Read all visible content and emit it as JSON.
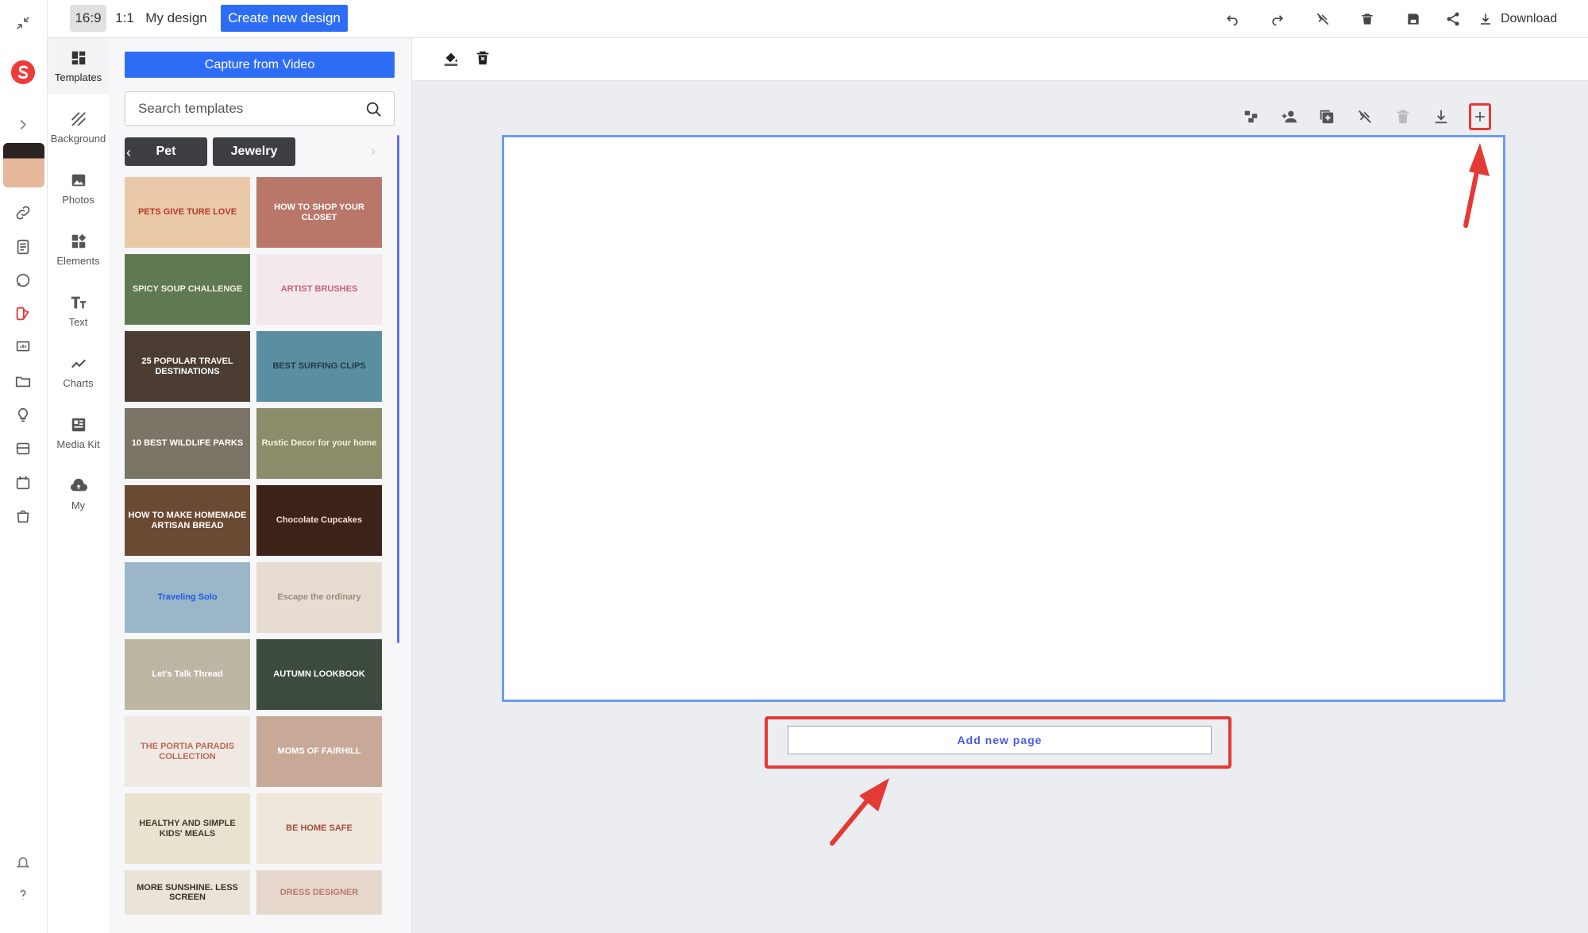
{
  "topbar": {
    "ratio_16_9": "16:9",
    "ratio_1_1": "1:1",
    "my_design": "My design",
    "create_new": "Create new design",
    "download": "Download"
  },
  "tools": [
    {
      "label": "Templates",
      "icon": "templates-icon"
    },
    {
      "label": "Background",
      "icon": "background-icon"
    },
    {
      "label": "Photos",
      "icon": "photos-icon"
    },
    {
      "label": "Elements",
      "icon": "elements-icon"
    },
    {
      "label": "Text",
      "icon": "text-icon"
    },
    {
      "label": "Charts",
      "icon": "charts-icon"
    },
    {
      "label": "Media Kit",
      "icon": "media-kit-icon"
    },
    {
      "label": "My",
      "icon": "upload-cloud-icon"
    }
  ],
  "panel": {
    "capture_button": "Capture from Video",
    "search_placeholder": "Search templates",
    "chips": [
      "Pet",
      "Jewelry"
    ],
    "templates": [
      {
        "text": "PETS GIVE TURE LOVE",
        "bg": "#e9c9a8",
        "fg": "#b23a2a"
      },
      {
        "text": "HOW TO SHOP YOUR CLOSET",
        "bg": "#b9776a",
        "fg": "#ffffff"
      },
      {
        "text": "SPICY SOUP CHALLENGE",
        "bg": "#5f7a52",
        "fg": "#f3efe2"
      },
      {
        "text": "ARTIST BRUSHES",
        "bg": "#f3e8ec",
        "fg": "#c2667c"
      },
      {
        "text": "25 POPULAR TRAVEL DESTINATIONS",
        "bg": "#4b3d34",
        "fg": "#ffffff"
      },
      {
        "text": "BEST SURFING CLIPS",
        "bg": "#5b8ea1",
        "fg": "#1f3a48"
      },
      {
        "text": "10 BEST WILDLIFE PARKS",
        "bg": "#7c7466",
        "fg": "#ffffff"
      },
      {
        "text": "Rustic Decor for your home",
        "bg": "#8a8c6a",
        "fg": "#f7f2e0"
      },
      {
        "text": "HOW TO MAKE HOMEMADE ARTISAN BREAD",
        "bg": "#6b4a33",
        "fg": "#ffffff"
      },
      {
        "text": "Chocolate Cupcakes",
        "bg": "#3b231a",
        "fg": "#f3e2cf"
      },
      {
        "text": "Traveling Solo",
        "bg": "#9cb6c9",
        "fg": "#1e5ae0"
      },
      {
        "text": "Escape the ordinary",
        "bg": "#e7dcd2",
        "fg": "#9c8a7c"
      },
      {
        "text": "Let's Talk Thread",
        "bg": "#bdb6a3",
        "fg": "#ffffff"
      },
      {
        "text": "AUTUMN LOOKBOOK",
        "bg": "#3d4a3e",
        "fg": "#ffffff"
      },
      {
        "text": "THE PORTIA PARADIS COLLECTION",
        "bg": "#f0e8e2",
        "fg": "#b86a55"
      },
      {
        "text": "MOMS OF FAIRHILL",
        "bg": "#c8a998",
        "fg": "#ffffff"
      },
      {
        "text": "HEALTHY AND SIMPLE KIDS' MEALS",
        "bg": "#e8e2cf",
        "fg": "#3e3a2e"
      },
      {
        "text": "BE HOME SAFE",
        "bg": "#efe6dc",
        "fg": "#a14f3a"
      },
      {
        "text": "MORE SUNSHINE. LESS SCREEN",
        "bg": "#e9e3d8",
        "fg": "#3a2f28"
      },
      {
        "text": "DRESS DESIGNER",
        "bg": "#e6d8cd",
        "fg": "#b87a66"
      }
    ]
  },
  "canvas": {
    "add_new_page": "Add new page"
  },
  "colors": {
    "accent": "#2d6df6",
    "highlight": "#e53935",
    "canvas_border": "#6c9bf2"
  }
}
